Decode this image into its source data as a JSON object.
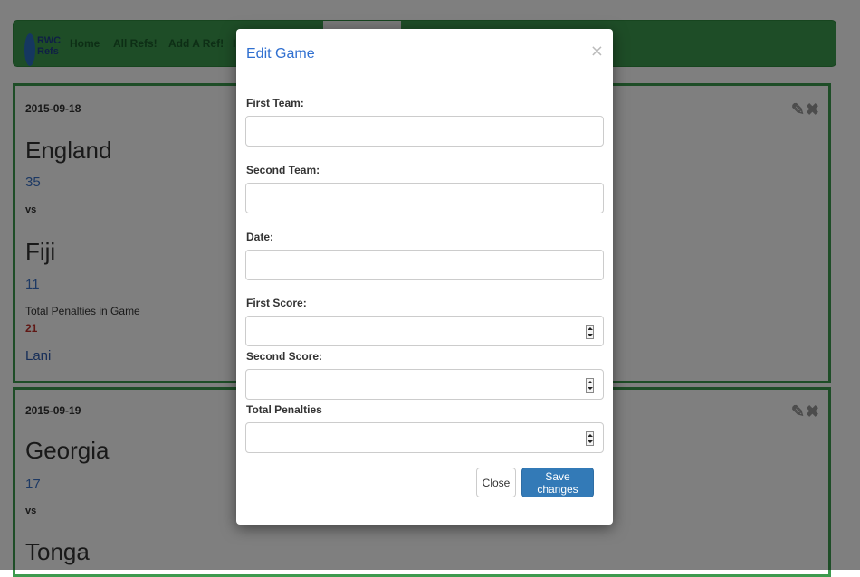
{
  "nav": {
    "logo_text": "RWC\nRefs",
    "links": [
      "Home",
      "All Refs!",
      "Add A Ref!",
      "I"
    ]
  },
  "games": [
    {
      "date": "2015-09-18",
      "team1": "England",
      "score1": "35",
      "vs": "vs",
      "team2": "Fiji",
      "score2": "11",
      "penalties_label": "Total Penalties in Game",
      "penalties": "21",
      "referee": "Lani"
    },
    {
      "date": "2015-09-19",
      "team1": "Georgia",
      "score1": "17",
      "vs": "vs",
      "team2": "Tonga"
    }
  ],
  "card_icons": [
    "edit-icon",
    "delete-icon"
  ],
  "modal": {
    "title": "Edit Game",
    "close_glyph": "×",
    "fields": [
      {
        "label": "First Team:",
        "value": "",
        "type": "text"
      },
      {
        "label": "Second Team:",
        "value": "",
        "type": "text"
      },
      {
        "label": "Date:",
        "value": "",
        "type": "text"
      },
      {
        "label": "First Score:",
        "value": "",
        "type": "number"
      },
      {
        "label": "Second Score:",
        "value": "",
        "type": "number"
      },
      {
        "label": "Total Penalties",
        "value": "",
        "type": "number"
      }
    ],
    "close_button": "Close",
    "save_button": "Save changes"
  },
  "colors": {
    "navbar_green": "#3d9a4e",
    "primary_blue": "#337ab7",
    "penalty_red": "#c0302b"
  }
}
